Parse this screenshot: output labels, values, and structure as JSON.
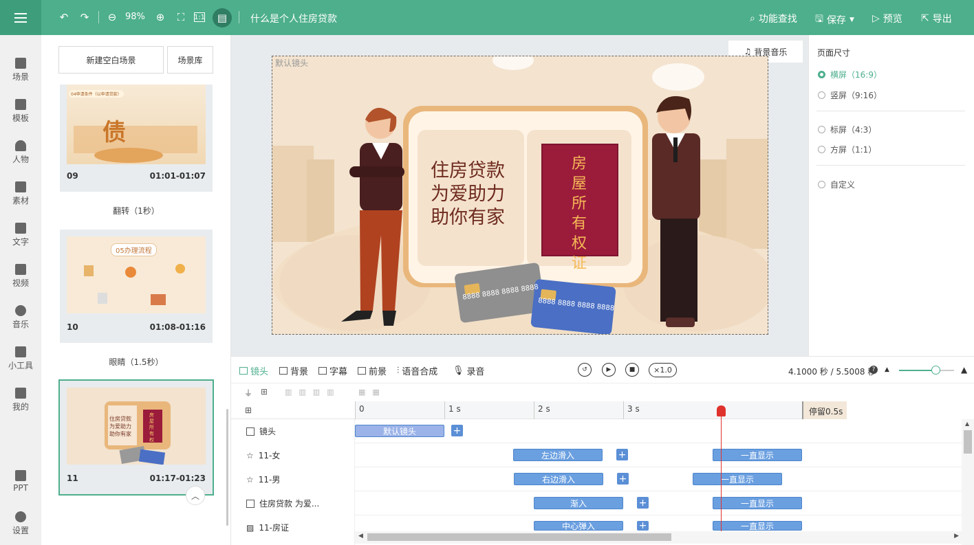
{
  "topbar": {
    "zoom": "98%",
    "doc_title": "什么是个人住房贷款",
    "find_label": "功能查找",
    "save_label": "保存",
    "preview_label": "预览",
    "export_label": "导出"
  },
  "nav": [
    {
      "label": "场景"
    },
    {
      "label": "模板"
    },
    {
      "label": "人物"
    },
    {
      "label": "素材"
    },
    {
      "label": "文字"
    },
    {
      "label": "视频"
    },
    {
      "label": "音乐"
    },
    {
      "label": "小工具"
    },
    {
      "label": "我的"
    },
    {
      "label": "PPT"
    },
    {
      "label": "设置"
    }
  ],
  "scenes": {
    "new_blank": "新建空白场景",
    "library": "场景库",
    "items": [
      {
        "num": "09",
        "time": "01:01-01:07",
        "thumb_heading": "04申请条件（以申请贷款）",
        "thumb_char": "债"
      },
      {
        "num": "10",
        "time": "01:08-01:16",
        "thumb_heading": "05办理流程"
      },
      {
        "num": "11",
        "time": "01:17-01:23",
        "thumb_text": "住房贷款为爱助力助你有家",
        "thumb_book": "房屋所有权"
      }
    ],
    "transitions": [
      "翻转（1秒）",
      "眼睛（1.5秒）"
    ]
  },
  "stage": {
    "camera_label": "默认镜头",
    "bg_music": "背景音乐",
    "book_text_lines": [
      "住房贷款",
      "为爱助力",
      "助你有家"
    ],
    "deed_chars": [
      "房",
      "屋",
      "所",
      "有",
      "权",
      "证"
    ],
    "card_number": "8888 8888 8888 8888"
  },
  "page_size": {
    "title": "页面尺寸",
    "options": [
      {
        "label": "横屏（16:9）",
        "selected": true
      },
      {
        "label": "竖屏（9:16）",
        "selected": false
      },
      {
        "label": "标屏（4:3）",
        "selected": false
      },
      {
        "label": "方屏（1:1）",
        "selected": false
      },
      {
        "label": "自定义",
        "selected": false
      }
    ]
  },
  "timeline": {
    "tabs": [
      "镜头",
      "背景",
      "字幕",
      "前景",
      "语音合成",
      "录音"
    ],
    "speed": "×1.0",
    "time_display": "4.1000 秒 / 5.5008 秒",
    "ruler": [
      "0",
      "1 s",
      "2 s",
      "3 s"
    ],
    "pause_label": "停留0.5s",
    "tracks": [
      {
        "label": "镜头",
        "clips": [
          "默认镜头"
        ]
      },
      {
        "label": "11-女",
        "clips": [
          "左边滑入",
          "一直显示"
        ]
      },
      {
        "label": "11-男",
        "clips": [
          "右边滑入",
          "一直显示"
        ]
      },
      {
        "label": "住房贷款 为爱...",
        "clips": [
          "渐入",
          "一直显示"
        ]
      },
      {
        "label": "11-房证",
        "clips": [
          "中心弹入",
          "一直显示"
        ]
      }
    ]
  },
  "colors": {
    "accent": "#4daf8c",
    "clip": "#6a9fe0",
    "deed": "#9b1b3b",
    "playhead": "#e0322c"
  }
}
